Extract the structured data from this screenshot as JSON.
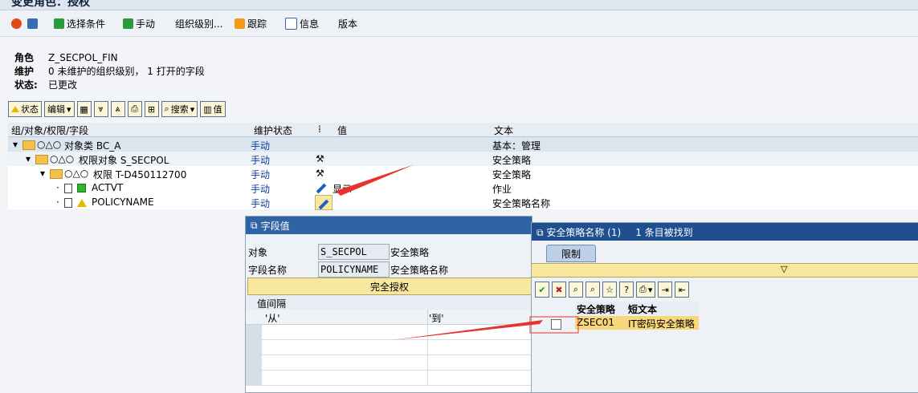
{
  "window": {
    "title": "变更角色：授权"
  },
  "app_toolbar": {
    "items": [
      {
        "label": ""
      },
      {
        "label": ""
      },
      {
        "label": "选择条件"
      },
      {
        "label": "手动"
      },
      {
        "label": "组织级别..."
      },
      {
        "label": "跟踪"
      },
      {
        "label": "信息"
      },
      {
        "label": "版本"
      }
    ]
  },
  "header": {
    "role_label": "角色",
    "role_value": "Z_SECPOL_FIN",
    "maint_label": "维护",
    "maint_value": "0 未维护的组织级别， 1 打开的字段",
    "status_label": "状态:",
    "status_value": "已更改"
  },
  "toolbar2": {
    "status": "状态",
    "edit": "编辑",
    "search": "搜索",
    "value": "值"
  },
  "tree": {
    "columns": {
      "c1": "组/对象/权限/字段",
      "c2": "维护状态",
      "c3": "值",
      "c4": "文本"
    },
    "rows": [
      {
        "label": "对象类 BC_A",
        "status": "手动",
        "value": "",
        "text": "基本：管理"
      },
      {
        "label": "权限对象 S_SECPOL",
        "status": "手动",
        "value": "",
        "text": "安全策略"
      },
      {
        "label": "权限 T-D450112700",
        "status": "手动",
        "value": "",
        "text": "安全策略"
      },
      {
        "label": "ACTVT",
        "status": "手动",
        "value": "显示",
        "text": "作业"
      },
      {
        "label": "POLICYNAME",
        "status": "手动",
        "value": "",
        "text": "安全策略名称"
      }
    ]
  },
  "dlg_field": {
    "title": "字段值",
    "object_label": "对象",
    "object_value": "S_SECPOL",
    "object_text": "安全策略",
    "field_label": "字段名称",
    "field_value": "POLICYNAME",
    "field_text": "安全策略名称",
    "full_auth": "完全授权",
    "interval": "值间隔",
    "from": "'从'",
    "to": "'到'"
  },
  "dlg_search": {
    "title": "安全策略名称 (1)",
    "found": "1 条目被找到",
    "tab": "限制",
    "col1": "安全策略",
    "col2": "短文本",
    "row_key": "ZSEC01",
    "row_text": "IT密码安全策略"
  },
  "colors": {
    "accent": "#2f64a4",
    "arrow": "#e8322b"
  }
}
